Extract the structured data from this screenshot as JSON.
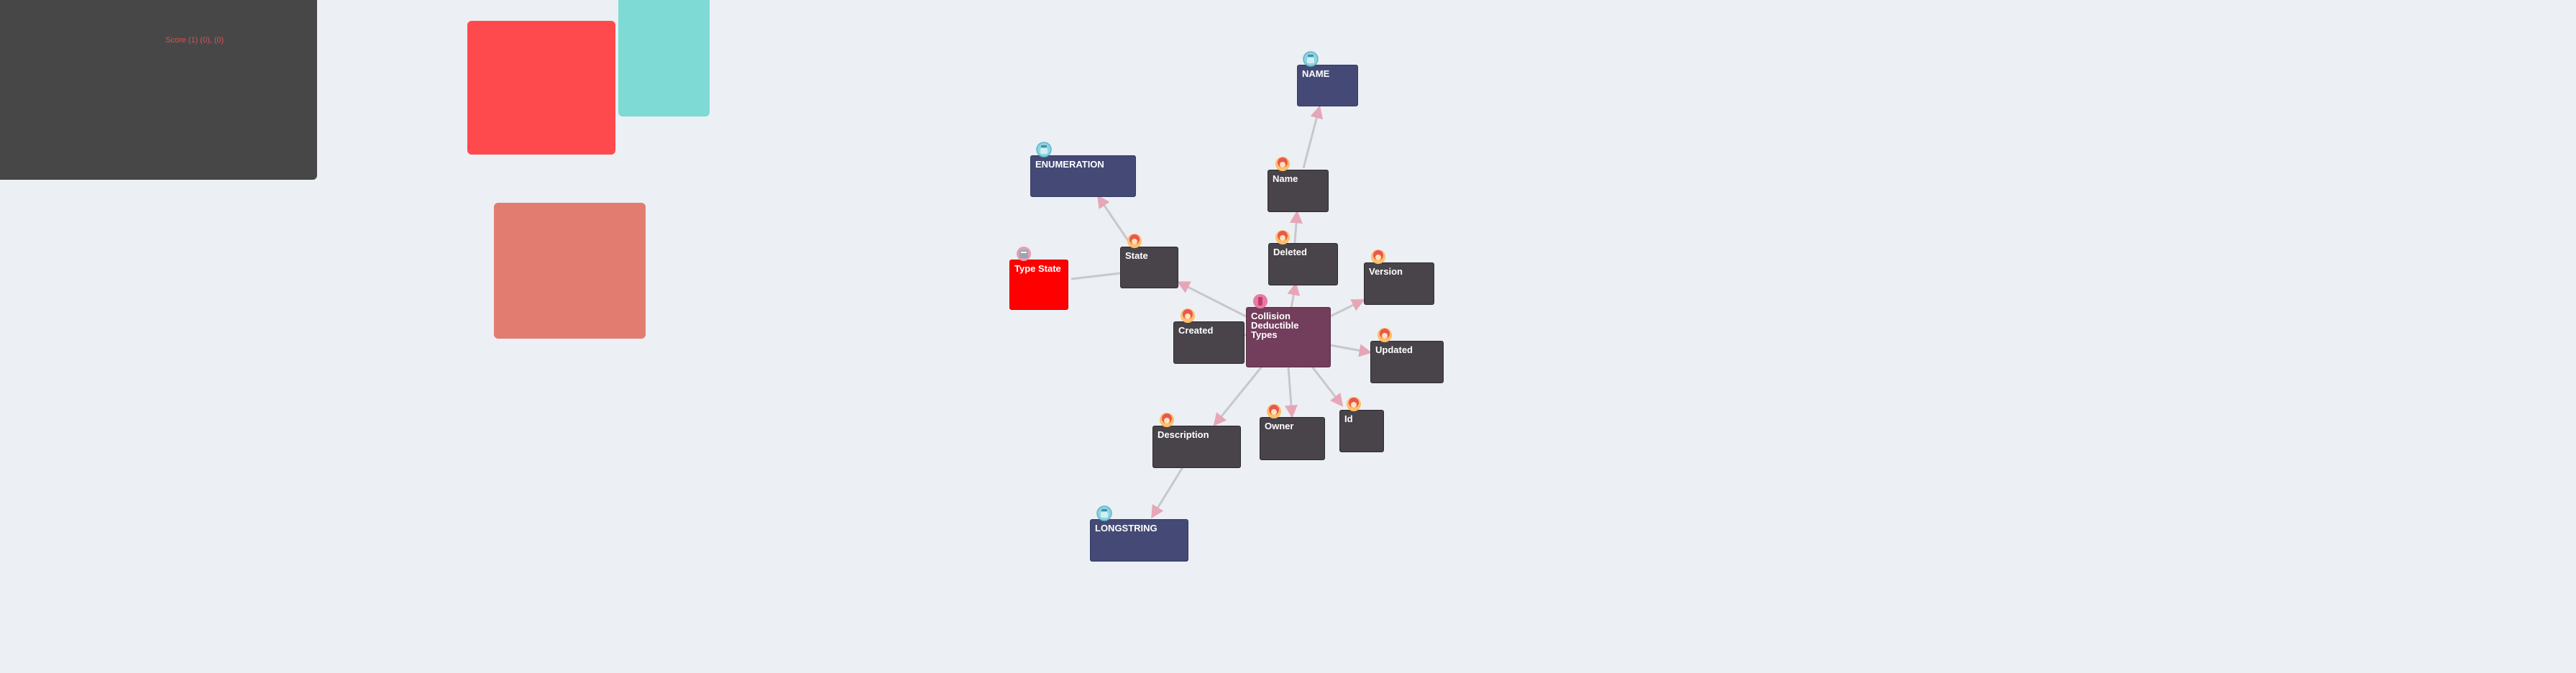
{
  "panel": {
    "label": "Score (1) (0), (0)"
  },
  "colors": {
    "background": "#eceff4",
    "panel": "#474748",
    "swatch_red": "#ff4a4d",
    "swatch_teal": "#7ddad5",
    "swatch_salmon": "#e27c70",
    "field_node": "#48444a",
    "type_node": "#444a75",
    "entity_node": "#723e5b",
    "enum_node": "#ff0000",
    "edge": "#c8c8cc",
    "arrow": "#e6a6b8"
  },
  "nodes": {
    "name_type": {
      "label": "NAME",
      "icon": "type-icon"
    },
    "name_field": {
      "label": "Name",
      "icon": "field-icon"
    },
    "enumeration": {
      "label": "ENUMERATION",
      "icon": "type-icon"
    },
    "state": {
      "label": "State",
      "icon": "field-icon"
    },
    "type_state": {
      "label": "Type State",
      "icon": "enum-icon"
    },
    "deleted": {
      "label": "Deleted",
      "icon": "field-icon"
    },
    "version": {
      "label": "Version",
      "icon": "field-icon"
    },
    "created": {
      "label": "Created",
      "icon": "field-icon"
    },
    "entity": {
      "label": "Collision Deductible Types",
      "icon": "entity-icon"
    },
    "updated": {
      "label": "Updated",
      "icon": "field-icon"
    },
    "description": {
      "label": "Description",
      "icon": "field-icon"
    },
    "owner": {
      "label": "Owner",
      "icon": "field-icon"
    },
    "id": {
      "label": "Id",
      "icon": "field-icon"
    },
    "longstring": {
      "label": "LONGSTRING",
      "icon": "type-icon"
    }
  }
}
